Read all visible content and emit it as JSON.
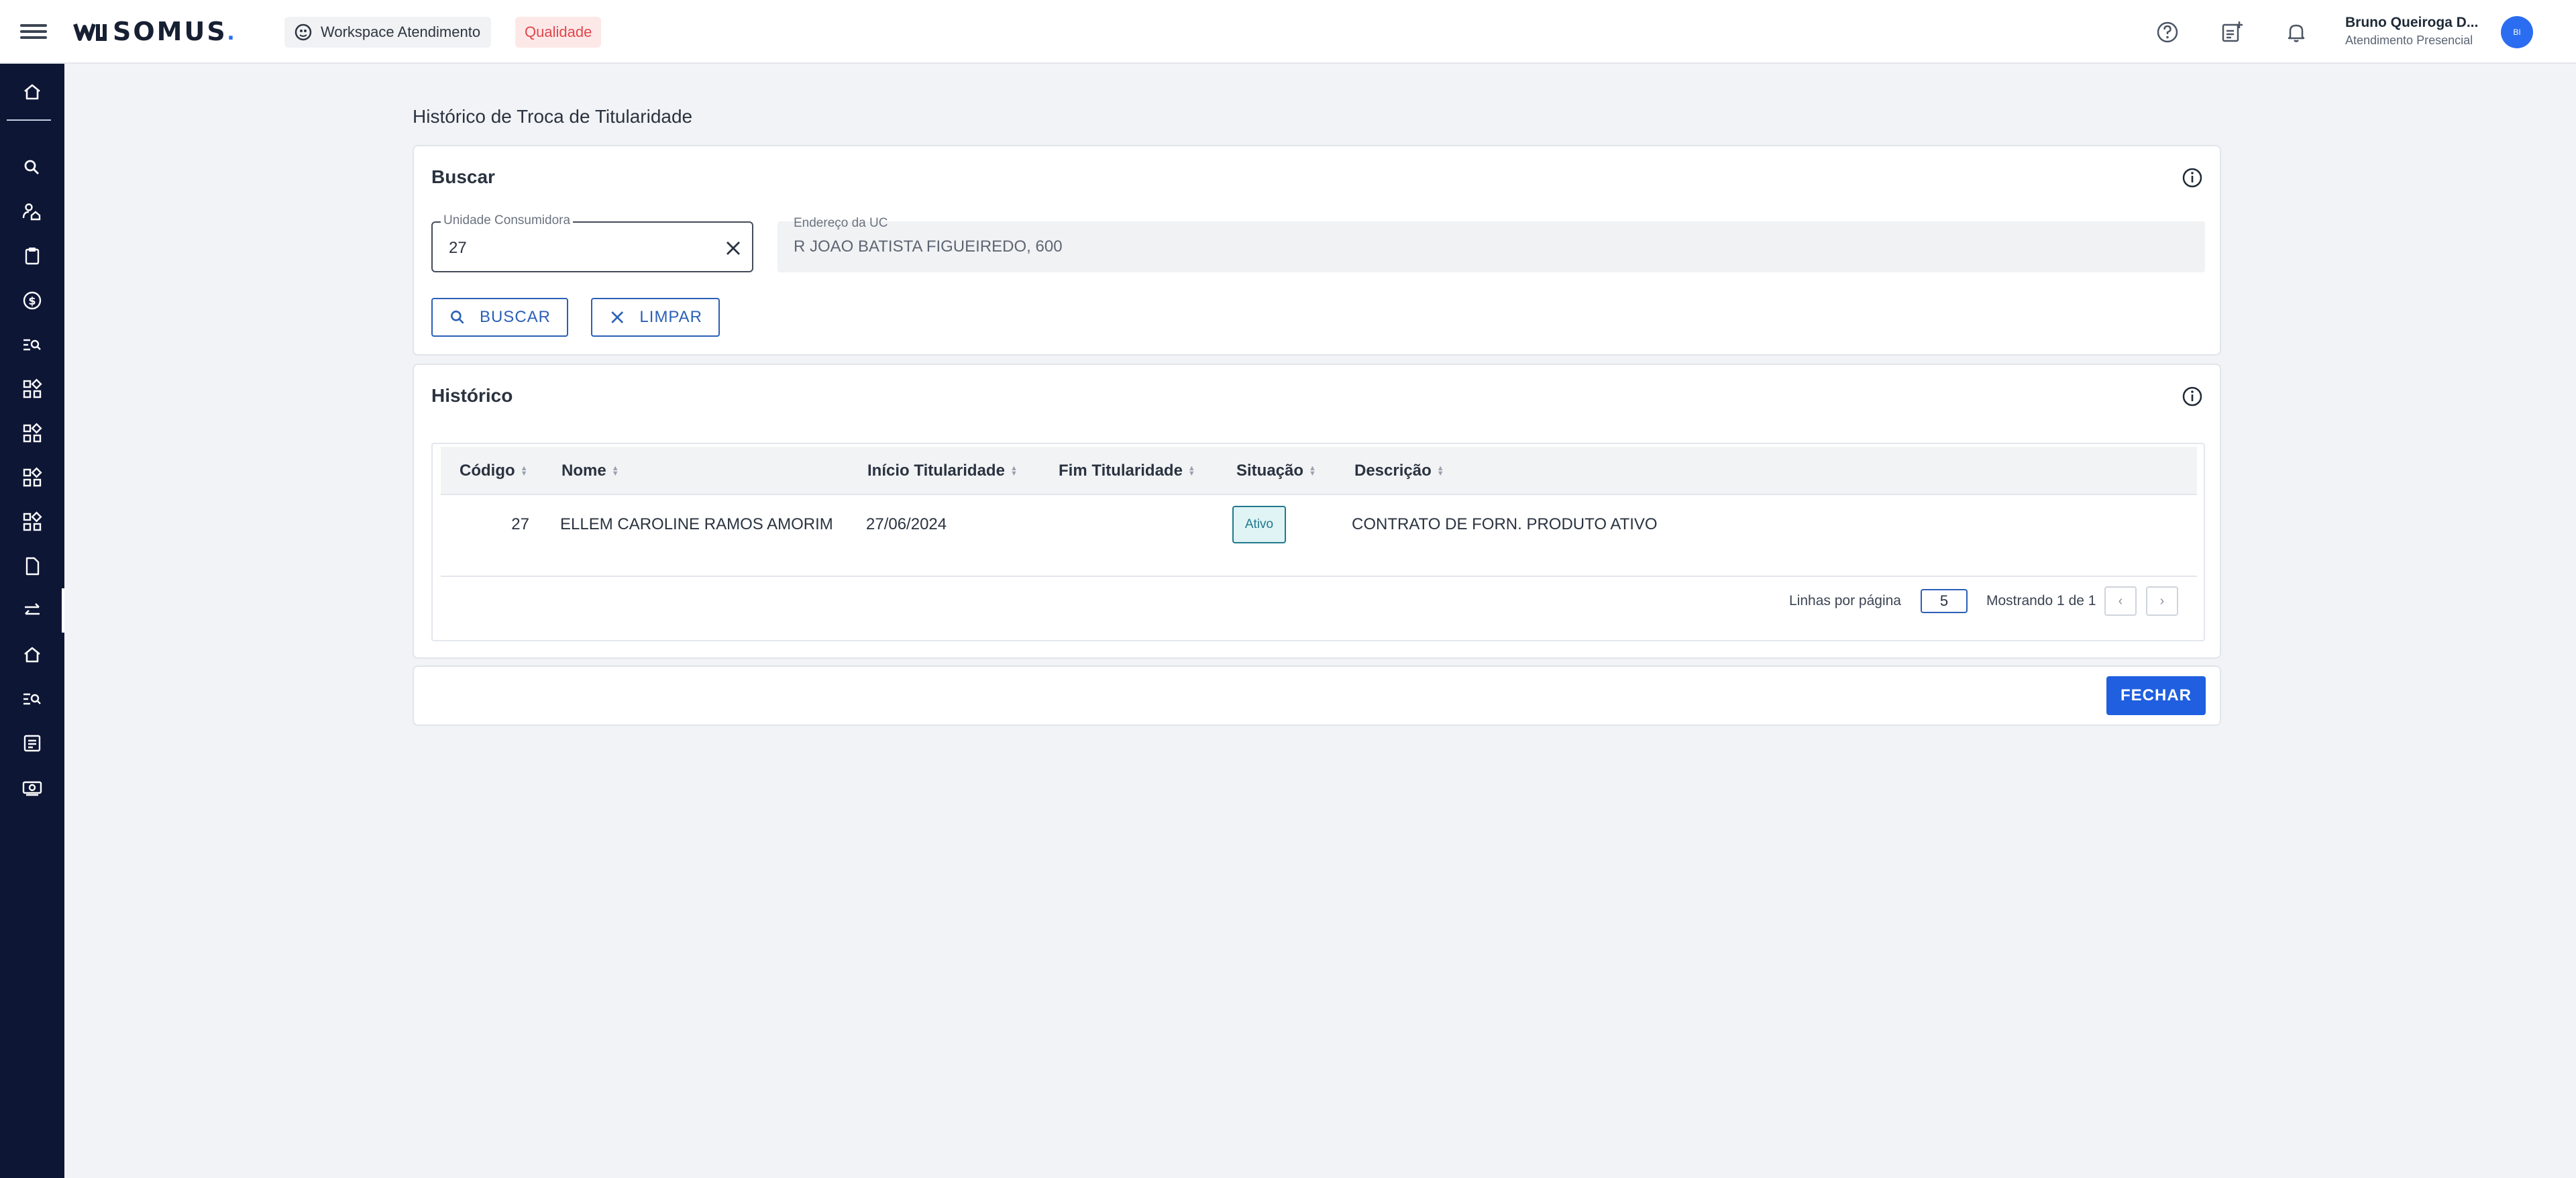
{
  "header": {
    "logo_text": "SOMUS",
    "logo_dot": ".",
    "workspace_label": "Workspace Atendimento",
    "environment_badge": "Qualidade",
    "icons": [
      "menu-icon",
      "help-icon",
      "add-note-icon",
      "bell-icon"
    ],
    "user": {
      "name": "Bruno Queiroga D...",
      "role": "Atendimento Presencial",
      "avatar_initials": "BI"
    }
  },
  "sidebar": {
    "items": [
      {
        "icon": "home-icon"
      },
      {
        "icon": "search-icon"
      },
      {
        "icon": "user-home-icon"
      },
      {
        "icon": "clipboard-icon"
      },
      {
        "icon": "dollar-icon"
      },
      {
        "icon": "list-search-icon"
      },
      {
        "icon": "apps-icon"
      },
      {
        "icon": "apps-icon"
      },
      {
        "icon": "apps-icon"
      },
      {
        "icon": "apps-icon"
      },
      {
        "icon": "document-icon"
      },
      {
        "icon": "swap-icon",
        "active": true
      },
      {
        "icon": "home-icon"
      },
      {
        "icon": "list-search-icon"
      },
      {
        "icon": "note-icon"
      },
      {
        "icon": "money-icon"
      }
    ]
  },
  "page": {
    "title": "Histórico de Troca de Titularidade"
  },
  "search": {
    "title": "Buscar",
    "uc_label": "Unidade Consumidora",
    "uc_value": "27",
    "address_label": "Endereço da UC",
    "address_value": "R JOAO BATISTA FIGUEIREDO, 600",
    "search_button": "BUSCAR",
    "clear_button": "LIMPAR"
  },
  "history": {
    "title": "Histórico",
    "columns": [
      "Código",
      "Nome",
      "Início Titularidade",
      "Fim Titularidade",
      "Situação",
      "Descrição"
    ],
    "rows": [
      {
        "codigo": "27",
        "nome": "ELLEM CAROLINE RAMOS AMORIM",
        "inicio": "27/06/2024",
        "fim": "",
        "situacao": "Ativo",
        "descricao": "CONTRATO DE FORN. PRODUTO ATIVO"
      }
    ],
    "pagination": {
      "rows_per_page_label": "Linhas por página",
      "rows_per_page": "5",
      "showing": "Mostrando 1 de 1",
      "prev": "‹",
      "next": "›"
    }
  },
  "footer": {
    "close_button": "FECHAR"
  },
  "colors": {
    "sidebar": "#0d1635",
    "primary": "#1f5fe0",
    "accent_outline": "#2b5fb8",
    "badge_bg": "#e0f3f5",
    "badge_text": "#1f7a8c",
    "quality_text": "#e0464a"
  }
}
